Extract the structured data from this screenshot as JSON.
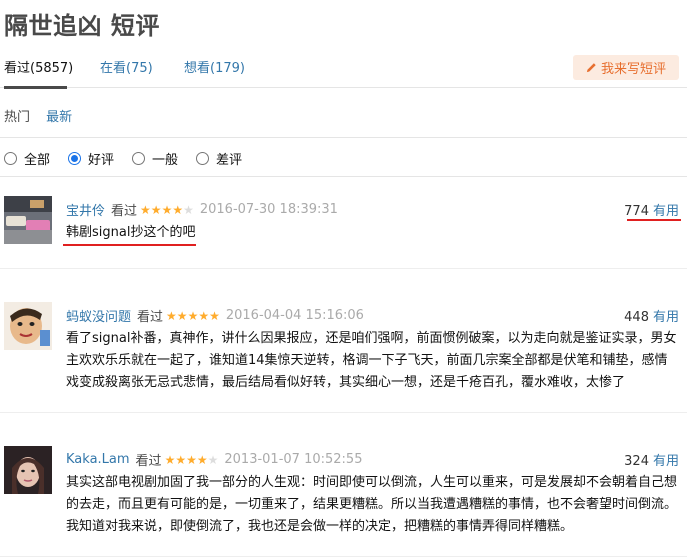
{
  "page": {
    "title": "隔世追凶 短评"
  },
  "tabs": [
    {
      "label": "看过(5857)"
    },
    {
      "label": "在看(75)"
    },
    {
      "label": "想看(179)"
    }
  ],
  "write_button": {
    "label": "我来写短评",
    "icon": "pencil-icon"
  },
  "sort": {
    "hot": "热门",
    "new": "最新"
  },
  "filters": [
    {
      "label": "全部",
      "checked": false
    },
    {
      "label": "好评",
      "checked": true
    },
    {
      "label": "一般",
      "checked": false
    },
    {
      "label": "差评",
      "checked": false
    }
  ],
  "comments": [
    {
      "user": "宝井伶",
      "status": "看过",
      "rating": 4,
      "time": "2016-07-30 18:39:31",
      "votes": "774",
      "useful": "有用",
      "text": "韩剧signal抄这个的吧"
    },
    {
      "user": "蚂蚁没问题",
      "status": "看过",
      "rating": 5,
      "time": "2016-04-04 15:16:06",
      "votes": "448",
      "useful": "有用",
      "text": "看了signal补番，真神作，讲什么因果报应，还是咱们强啊，前面惯例破案，以为走向就是鉴证实录，男女主欢欢乐乐就在一起了，谁知道14集惊天逆转，格调一下子飞天，前面几宗案全部都是伏笔和铺垫，感情戏变成殺离张无忌式悲情，最后结局看似好转，其实细心一想，还是千疮百孔，覆水难收，太惨了"
    },
    {
      "user": "Kaka.Lam",
      "status": "看过",
      "rating": 4,
      "time": "2013-01-07 10:52:55",
      "votes": "324",
      "useful": "有用",
      "text": "其实这部电视剧加固了我一部分的人生观：时间即使可以倒流，人生可以重来，可是发展却不会朝着自己想的去走，而且更有可能的是，一切重来了，结果更糟糕。所以当我遭遇糟糕的事情，也不会奢望时间倒流。我知道对我来说，即使倒流了，我也还是会做一样的决定，把糟糕的事情弄得同样糟糕。"
    }
  ],
  "colors": {
    "link": "#3377aa",
    "star": "#ffac2d",
    "highlight": "#e02020",
    "button_bg": "#fcebe0",
    "button_text": "#e76f2f"
  }
}
